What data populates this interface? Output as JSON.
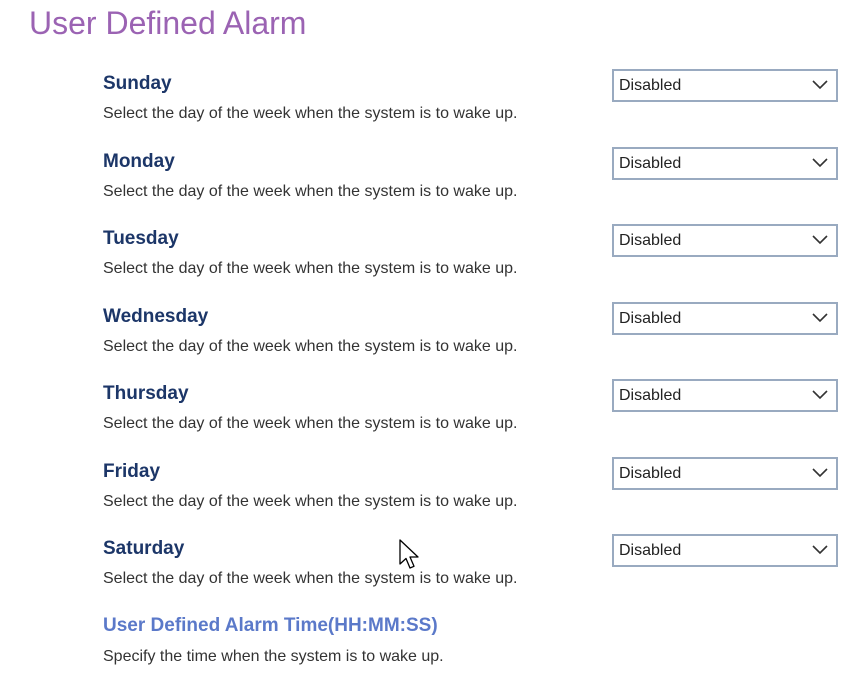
{
  "page": {
    "title": "User Defined Alarm"
  },
  "days": [
    {
      "name": "Sunday",
      "description": "Select the day of the week when the system is to wake up.",
      "value": "Disabled"
    },
    {
      "name": "Monday",
      "description": "Select the day of the week when the system is to wake up.",
      "value": "Disabled"
    },
    {
      "name": "Tuesday",
      "description": "Select the day of the week when the system is to wake up.",
      "value": "Disabled"
    },
    {
      "name": "Wednesday",
      "description": "Select the day of the week when the system is to wake up.",
      "value": "Disabled"
    },
    {
      "name": "Thursday",
      "description": "Select the day of the week when the system is to wake up.",
      "value": "Disabled"
    },
    {
      "name": "Friday",
      "description": "Select the day of the week when the system is to wake up.",
      "value": "Disabled"
    },
    {
      "name": "Saturday",
      "description": "Select the day of the week when the system is to wake up.",
      "value": "Disabled"
    }
  ],
  "alarm_time": {
    "name": "User Defined Alarm Time(HH:MM:SS)",
    "description": "Specify the time when the system is to wake up."
  },
  "colors": {
    "title": "#9b63b3",
    "setting_name": "#1c3668",
    "highlight_setting_name": "#5b79c9",
    "select_border": "#99aac0"
  },
  "icons": {
    "dropdown": "chevron-down-icon",
    "pointer": "mouse-cursor-icon"
  }
}
